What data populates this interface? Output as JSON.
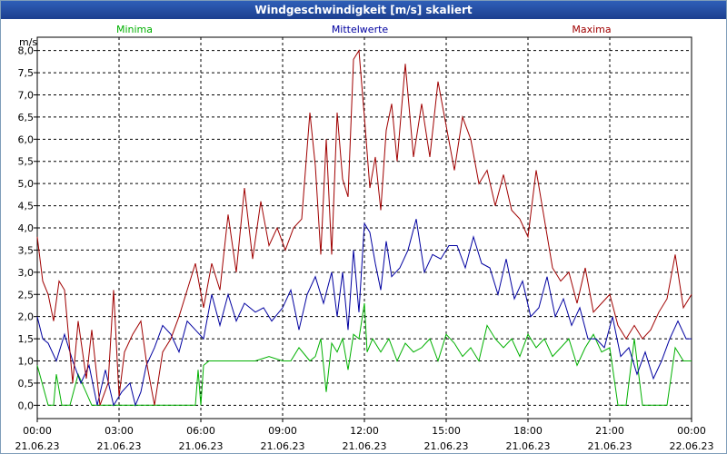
{
  "window": {
    "title": "Windgeschwindigkeit [m/s] skaliert"
  },
  "chart_data": {
    "type": "line",
    "title": "Windgeschwindigkeit [m/s] skaliert",
    "ylabel": "m/s",
    "ylim": [
      -0.3,
      8.3
    ],
    "xlim": [
      0,
      24
    ],
    "y_ticks": [
      "0,0",
      "0,5",
      "1,0",
      "1,5",
      "2,0",
      "2,5",
      "3,0",
      "3,5",
      "4,0",
      "4,5",
      "5,0",
      "5,5",
      "6,0",
      "6,5",
      "7,0",
      "7,5",
      "8,0"
    ],
    "x_ticks": [
      {
        "time": "00:00",
        "date": "21.06.23"
      },
      {
        "time": "03:00",
        "date": "21.06.23"
      },
      {
        "time": "06:00",
        "date": "21.06.23"
      },
      {
        "time": "09:00",
        "date": "21.06.23"
      },
      {
        "time": "12:00",
        "date": "21.06.23"
      },
      {
        "time": "15:00",
        "date": "21.06.23"
      },
      {
        "time": "18:00",
        "date": "21.06.23"
      },
      {
        "time": "21:00",
        "date": "21.06.23"
      },
      {
        "time": "00:00",
        "date": "22.06.23"
      }
    ],
    "grid": true,
    "legend_position": "top",
    "series": [
      {
        "name": "Minima",
        "color": "#00b000",
        "x": [
          0,
          0.4,
          0.6,
          0.7,
          0.9,
          1.2,
          1.5,
          2.0,
          2.3,
          2.6,
          3.0,
          3.3,
          3.6,
          3.9,
          4.2,
          4.6,
          5.0,
          5.5,
          5.8,
          5.9,
          6.0,
          6.1,
          6.3,
          6.6,
          7.0,
          7.5,
          8.0,
          8.5,
          9.0,
          9.3,
          9.6,
          10.0,
          10.2,
          10.4,
          10.6,
          10.8,
          11.0,
          11.2,
          11.4,
          11.6,
          11.8,
          12.0,
          12.1,
          12.3,
          12.6,
          12.9,
          13.2,
          13.5,
          13.8,
          14.1,
          14.4,
          14.7,
          15.0,
          15.3,
          15.6,
          15.9,
          16.2,
          16.5,
          16.8,
          17.1,
          17.4,
          17.7,
          18.0,
          18.3,
          18.6,
          18.9,
          19.2,
          19.5,
          19.8,
          20.1,
          20.4,
          20.7,
          21.0,
          21.3,
          21.6,
          21.9,
          22.2,
          22.5,
          22.8,
          23.1,
          23.4,
          23.7,
          24.0
        ],
        "values": [
          0.9,
          0,
          0,
          0.7,
          0,
          0,
          0.7,
          0,
          0,
          0,
          0,
          0,
          0,
          0,
          0,
          0,
          0,
          0,
          0,
          0.8,
          0,
          0.9,
          1.0,
          1.0,
          1.0,
          1.0,
          1.0,
          1.1,
          1.0,
          1.0,
          1.3,
          1.0,
          1.1,
          1.5,
          0.3,
          1.4,
          1.2,
          1.5,
          0.8,
          1.6,
          1.5,
          2.3,
          1.2,
          1.5,
          1.2,
          1.5,
          1.0,
          1.4,
          1.2,
          1.3,
          1.5,
          1.0,
          1.6,
          1.4,
          1.1,
          1.3,
          1.0,
          1.8,
          1.5,
          1.3,
          1.5,
          1.1,
          1.6,
          1.3,
          1.5,
          1.1,
          1.3,
          1.5,
          0.9,
          1.3,
          1.6,
          1.2,
          1.3,
          0,
          0,
          1.5,
          0,
          0,
          0,
          0,
          1.3,
          1.0,
          1.0
        ]
      },
      {
        "name": "Mittelwerte",
        "color": "#0000a0",
        "x": [
          0,
          0.2,
          0.4,
          0.7,
          1.0,
          1.3,
          1.6,
          1.9,
          2.2,
          2.5,
          2.8,
          3.1,
          3.4,
          3.6,
          3.8,
          4.0,
          4.3,
          4.6,
          4.9,
          5.2,
          5.5,
          5.8,
          6.1,
          6.4,
          6.7,
          7.0,
          7.3,
          7.6,
          8.0,
          8.3,
          8.6,
          9.0,
          9.3,
          9.6,
          9.9,
          10.2,
          10.5,
          10.8,
          11.0,
          11.2,
          11.4,
          11.6,
          11.8,
          12.0,
          12.2,
          12.4,
          12.6,
          12.8,
          13.0,
          13.3,
          13.6,
          13.9,
          14.2,
          14.5,
          14.8,
          15.1,
          15.4,
          15.7,
          16.0,
          16.3,
          16.6,
          16.9,
          17.2,
          17.5,
          17.8,
          18.1,
          18.4,
          18.7,
          19.0,
          19.3,
          19.6,
          19.9,
          20.2,
          20.5,
          20.8,
          21.1,
          21.4,
          21.7,
          22.0,
          22.3,
          22.6,
          22.9,
          23.2,
          23.5,
          23.8,
          24.0
        ],
        "values": [
          2.0,
          1.5,
          1.4,
          1.0,
          1.6,
          1.0,
          0.5,
          0.9,
          0.0,
          0.8,
          0.0,
          0.3,
          0.5,
          0.0,
          0.3,
          0.9,
          1.3,
          1.8,
          1.6,
          1.2,
          1.9,
          1.7,
          1.5,
          2.5,
          1.8,
          2.5,
          1.9,
          2.3,
          2.1,
          2.2,
          1.9,
          2.2,
          2.6,
          1.7,
          2.5,
          2.9,
          2.3,
          3.0,
          2.0,
          3.0,
          1.7,
          3.5,
          2.1,
          4.1,
          3.9,
          3.2,
          2.6,
          3.7,
          2.9,
          3.1,
          3.5,
          4.2,
          3.0,
          3.4,
          3.3,
          3.6,
          3.6,
          3.1,
          3.8,
          3.2,
          3.1,
          2.5,
          3.3,
          2.4,
          2.8,
          2.0,
          2.2,
          2.9,
          2.0,
          2.4,
          1.8,
          2.2,
          1.5,
          1.5,
          1.3,
          2.0,
          1.1,
          1.3,
          0.7,
          1.2,
          0.6,
          1.0,
          1.5,
          1.9,
          1.5,
          1.5
        ]
      },
      {
        "name": "Maxima",
        "color": "#a00000",
        "x": [
          0,
          0.2,
          0.4,
          0.6,
          0.8,
          1.0,
          1.3,
          1.5,
          1.8,
          2.0,
          2.3,
          2.6,
          2.8,
          3.0,
          3.2,
          3.5,
          3.8,
          4.0,
          4.3,
          4.6,
          4.9,
          5.2,
          5.5,
          5.8,
          6.1,
          6.4,
          6.7,
          7.0,
          7.3,
          7.6,
          7.9,
          8.2,
          8.5,
          8.8,
          9.1,
          9.4,
          9.7,
          10.0,
          10.2,
          10.4,
          10.6,
          10.8,
          11.0,
          11.2,
          11.4,
          11.6,
          11.8,
          12.0,
          12.2,
          12.4,
          12.6,
          12.8,
          13.0,
          13.2,
          13.5,
          13.8,
          14.1,
          14.4,
          14.7,
          15.0,
          15.3,
          15.6,
          15.9,
          16.2,
          16.5,
          16.8,
          17.1,
          17.4,
          17.7,
          18.0,
          18.3,
          18.6,
          18.9,
          19.2,
          19.5,
          19.8,
          20.1,
          20.4,
          20.7,
          21.0,
          21.3,
          21.6,
          21.9,
          22.2,
          22.5,
          22.8,
          23.1,
          23.4,
          23.7,
          24.0
        ],
        "values": [
          3.8,
          2.8,
          2.5,
          1.9,
          2.8,
          2.6,
          0.5,
          1.9,
          0.6,
          1.7,
          0.0,
          0.5,
          2.6,
          0.2,
          1.2,
          1.6,
          1.9,
          1.0,
          0.0,
          1.2,
          1.5,
          2.0,
          2.6,
          3.2,
          2.2,
          3.2,
          2.6,
          4.3,
          3.0,
          4.9,
          3.3,
          4.6,
          3.6,
          4.0,
          3.5,
          4.0,
          4.2,
          6.6,
          5.4,
          3.4,
          6.0,
          3.4,
          6.6,
          5.1,
          4.7,
          7.8,
          8.0,
          6.5,
          4.9,
          5.6,
          4.4,
          6.2,
          6.8,
          5.5,
          7.7,
          5.6,
          6.8,
          5.6,
          7.3,
          6.3,
          5.3,
          6.5,
          6.0,
          5.0,
          5.3,
          4.5,
          5.2,
          4.4,
          4.2,
          3.8,
          5.3,
          4.2,
          3.1,
          2.8,
          3.0,
          2.3,
          3.1,
          2.1,
          2.3,
          2.5,
          1.8,
          1.5,
          1.8,
          1.5,
          1.7,
          2.1,
          2.4,
          3.4,
          2.2,
          2.5
        ]
      }
    ]
  }
}
